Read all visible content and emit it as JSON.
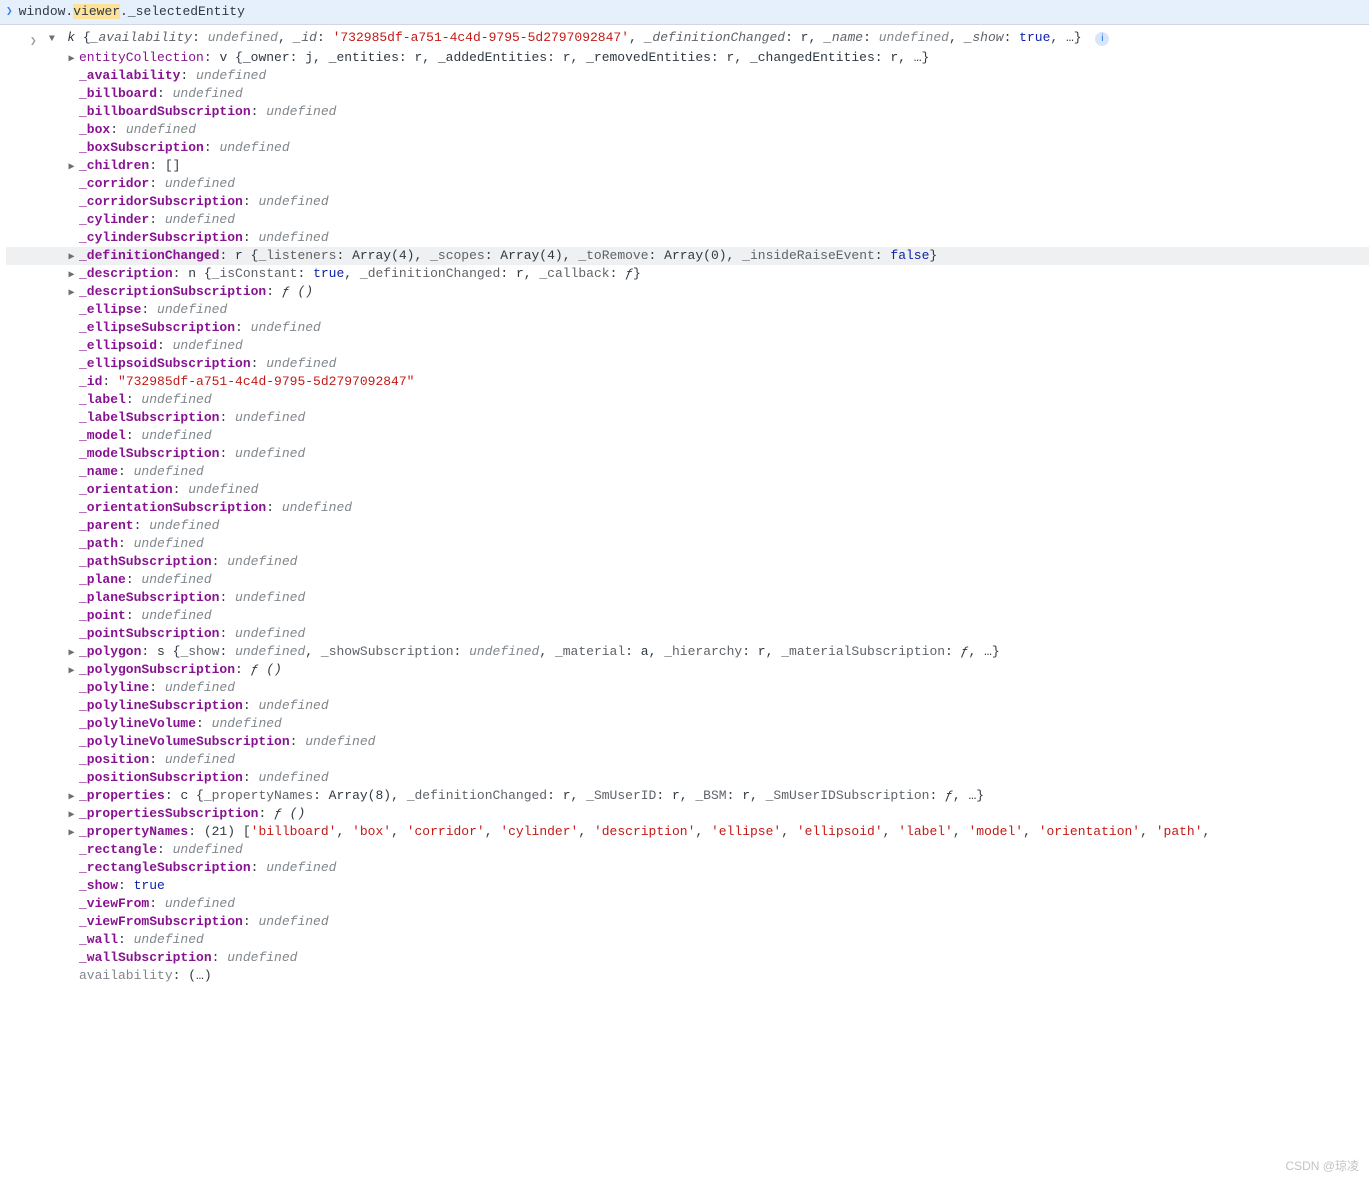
{
  "input": {
    "prefix": "window.",
    "highlight": "viewer",
    "suffix": "._selectedEntity"
  },
  "header": {
    "class": "k",
    "preview": [
      {
        "k": "_availability",
        "v": "undefined",
        "t": "und"
      },
      {
        "k": "_id",
        "v": "'732985df-a751-4c4d-9795-5d2797092847'",
        "t": "str"
      },
      {
        "k": "_definitionChanged",
        "v": "r",
        "t": "dark"
      },
      {
        "k": "_name",
        "v": "undefined",
        "t": "und"
      },
      {
        "k": "_show",
        "v": "true",
        "t": "bool"
      }
    ],
    "ellipsis": "…"
  },
  "rows": [
    {
      "tw": "right",
      "key": "entityCollection",
      "bold": false,
      "inline": "v {_owner: j, _entities: r, _addedEntities: r, _removedEntities: r, _changedEntities: r, …}"
    },
    {
      "tw": "none",
      "key": "_availability",
      "bold": true,
      "val": "undefined",
      "vt": "und"
    },
    {
      "tw": "none",
      "key": "_billboard",
      "bold": true,
      "val": "undefined",
      "vt": "und"
    },
    {
      "tw": "none",
      "key": "_billboardSubscription",
      "bold": true,
      "val": "undefined",
      "vt": "und"
    },
    {
      "tw": "none",
      "key": "_box",
      "bold": true,
      "val": "undefined",
      "vt": "und"
    },
    {
      "tw": "none",
      "key": "_boxSubscription",
      "bold": true,
      "val": "undefined",
      "vt": "und"
    },
    {
      "tw": "right",
      "key": "_children",
      "bold": true,
      "val": "[]",
      "vt": "dark"
    },
    {
      "tw": "none",
      "key": "_corridor",
      "bold": true,
      "val": "undefined",
      "vt": "und"
    },
    {
      "tw": "none",
      "key": "_corridorSubscription",
      "bold": true,
      "val": "undefined",
      "vt": "und"
    },
    {
      "tw": "none",
      "key": "_cylinder",
      "bold": true,
      "val": "undefined",
      "vt": "und"
    },
    {
      "tw": "none",
      "key": "_cylinderSubscription",
      "bold": true,
      "val": "undefined",
      "vt": "und"
    },
    {
      "tw": "right",
      "key": "_definitionChanged",
      "bold": true,
      "hover": true,
      "inlineParts": [
        {
          "txt": "r {",
          "t": "dark"
        },
        {
          "txt": "_listeners",
          "t": "grey"
        },
        {
          "txt": ": Array(4), ",
          "t": "dark"
        },
        {
          "txt": "_scopes",
          "t": "grey"
        },
        {
          "txt": ": Array(4), ",
          "t": "dark"
        },
        {
          "txt": "_toRemove",
          "t": "grey"
        },
        {
          "txt": ": Array(0), ",
          "t": "dark"
        },
        {
          "txt": "_insideRaiseEvent",
          "t": "grey"
        },
        {
          "txt": ": ",
          "t": "dark"
        },
        {
          "txt": "false",
          "t": "bool"
        },
        {
          "txt": "}",
          "t": "dark"
        }
      ]
    },
    {
      "tw": "right",
      "key": "_description",
      "bold": true,
      "inlineParts": [
        {
          "txt": "n {",
          "t": "dark"
        },
        {
          "txt": "_isConstant",
          "t": "grey"
        },
        {
          "txt": ": ",
          "t": "dark"
        },
        {
          "txt": "true",
          "t": "bool"
        },
        {
          "txt": ", ",
          "t": "dark"
        },
        {
          "txt": "_definitionChanged",
          "t": "grey"
        },
        {
          "txt": ": r, ",
          "t": "dark"
        },
        {
          "txt": "_callback",
          "t": "grey"
        },
        {
          "txt": ": ",
          "t": "dark"
        },
        {
          "txt": "ƒ",
          "t": "fn"
        },
        {
          "txt": "}",
          "t": "dark"
        }
      ]
    },
    {
      "tw": "right",
      "key": "_descriptionSubscription",
      "bold": true,
      "val": "ƒ ()",
      "vt": "fn"
    },
    {
      "tw": "none",
      "key": "_ellipse",
      "bold": true,
      "val": "undefined",
      "vt": "und"
    },
    {
      "tw": "none",
      "key": "_ellipseSubscription",
      "bold": true,
      "val": "undefined",
      "vt": "und"
    },
    {
      "tw": "none",
      "key": "_ellipsoid",
      "bold": true,
      "val": "undefined",
      "vt": "und"
    },
    {
      "tw": "none",
      "key": "_ellipsoidSubscription",
      "bold": true,
      "val": "undefined",
      "vt": "und"
    },
    {
      "tw": "none",
      "key": "_id",
      "bold": true,
      "val": "\"732985df-a751-4c4d-9795-5d2797092847\"",
      "vt": "str"
    },
    {
      "tw": "none",
      "key": "_label",
      "bold": true,
      "val": "undefined",
      "vt": "und"
    },
    {
      "tw": "none",
      "key": "_labelSubscription",
      "bold": true,
      "val": "undefined",
      "vt": "und"
    },
    {
      "tw": "none",
      "key": "_model",
      "bold": true,
      "val": "undefined",
      "vt": "und"
    },
    {
      "tw": "none",
      "key": "_modelSubscription",
      "bold": true,
      "val": "undefined",
      "vt": "und"
    },
    {
      "tw": "none",
      "key": "_name",
      "bold": true,
      "val": "undefined",
      "vt": "und"
    },
    {
      "tw": "none",
      "key": "_orientation",
      "bold": true,
      "val": "undefined",
      "vt": "und"
    },
    {
      "tw": "none",
      "key": "_orientationSubscription",
      "bold": true,
      "val": "undefined",
      "vt": "und"
    },
    {
      "tw": "none",
      "key": "_parent",
      "bold": true,
      "val": "undefined",
      "vt": "und"
    },
    {
      "tw": "none",
      "key": "_path",
      "bold": true,
      "val": "undefined",
      "vt": "und"
    },
    {
      "tw": "none",
      "key": "_pathSubscription",
      "bold": true,
      "val": "undefined",
      "vt": "und"
    },
    {
      "tw": "none",
      "key": "_plane",
      "bold": true,
      "val": "undefined",
      "vt": "und"
    },
    {
      "tw": "none",
      "key": "_planeSubscription",
      "bold": true,
      "val": "undefined",
      "vt": "und"
    },
    {
      "tw": "none",
      "key": "_point",
      "bold": true,
      "val": "undefined",
      "vt": "und"
    },
    {
      "tw": "none",
      "key": "_pointSubscription",
      "bold": true,
      "val": "undefined",
      "vt": "und"
    },
    {
      "tw": "right",
      "key": "_polygon",
      "bold": true,
      "inlineParts": [
        {
          "txt": "s {",
          "t": "dark"
        },
        {
          "txt": "_show",
          "t": "grey"
        },
        {
          "txt": ": ",
          "t": "dark"
        },
        {
          "txt": "undefined",
          "t": "und"
        },
        {
          "txt": ", ",
          "t": "dark"
        },
        {
          "txt": "_showSubscription",
          "t": "grey"
        },
        {
          "txt": ": ",
          "t": "dark"
        },
        {
          "txt": "undefined",
          "t": "und"
        },
        {
          "txt": ", ",
          "t": "dark"
        },
        {
          "txt": "_material",
          "t": "grey"
        },
        {
          "txt": ": a, ",
          "t": "dark"
        },
        {
          "txt": "_hierarchy",
          "t": "grey"
        },
        {
          "txt": ": r, ",
          "t": "dark"
        },
        {
          "txt": "_materialSubscription",
          "t": "grey"
        },
        {
          "txt": ": ",
          "t": "dark"
        },
        {
          "txt": "ƒ",
          "t": "fn"
        },
        {
          "txt": ", …}",
          "t": "dark"
        }
      ]
    },
    {
      "tw": "right",
      "key": "_polygonSubscription",
      "bold": true,
      "val": "ƒ ()",
      "vt": "fn"
    },
    {
      "tw": "none",
      "key": "_polyline",
      "bold": true,
      "val": "undefined",
      "vt": "und"
    },
    {
      "tw": "none",
      "key": "_polylineSubscription",
      "bold": true,
      "val": "undefined",
      "vt": "und"
    },
    {
      "tw": "none",
      "key": "_polylineVolume",
      "bold": true,
      "val": "undefined",
      "vt": "und"
    },
    {
      "tw": "none",
      "key": "_polylineVolumeSubscription",
      "bold": true,
      "val": "undefined",
      "vt": "und"
    },
    {
      "tw": "none",
      "key": "_position",
      "bold": true,
      "val": "undefined",
      "vt": "und"
    },
    {
      "tw": "none",
      "key": "_positionSubscription",
      "bold": true,
      "val": "undefined",
      "vt": "und"
    },
    {
      "tw": "right",
      "key": "_properties",
      "bold": true,
      "inlineParts": [
        {
          "txt": "c {",
          "t": "dark"
        },
        {
          "txt": "_propertyNames",
          "t": "grey"
        },
        {
          "txt": ": Array(8), ",
          "t": "dark"
        },
        {
          "txt": "_definitionChanged",
          "t": "grey"
        },
        {
          "txt": ": r, ",
          "t": "dark"
        },
        {
          "txt": "_SmUserID",
          "t": "grey"
        },
        {
          "txt": ": r, ",
          "t": "dark"
        },
        {
          "txt": "_BSM",
          "t": "grey"
        },
        {
          "txt": ": r, ",
          "t": "dark"
        },
        {
          "txt": "_SmUserIDSubscription",
          "t": "grey"
        },
        {
          "txt": ": ",
          "t": "dark"
        },
        {
          "txt": "ƒ",
          "t": "fn"
        },
        {
          "txt": ", …}",
          "t": "dark"
        }
      ]
    },
    {
      "tw": "right",
      "key": "_propertiesSubscription",
      "bold": true,
      "val": "ƒ ()",
      "vt": "fn"
    },
    {
      "tw": "right",
      "key": "_propertyNames",
      "bold": true,
      "inlineParts": [
        {
          "txt": "(21) [",
          "t": "dark"
        },
        {
          "txt": "'billboard'",
          "t": "str"
        },
        {
          "txt": ", ",
          "t": "dark"
        },
        {
          "txt": "'box'",
          "t": "str"
        },
        {
          "txt": ", ",
          "t": "dark"
        },
        {
          "txt": "'corridor'",
          "t": "str"
        },
        {
          "txt": ", ",
          "t": "dark"
        },
        {
          "txt": "'cylinder'",
          "t": "str"
        },
        {
          "txt": ", ",
          "t": "dark"
        },
        {
          "txt": "'description'",
          "t": "str"
        },
        {
          "txt": ", ",
          "t": "dark"
        },
        {
          "txt": "'ellipse'",
          "t": "str"
        },
        {
          "txt": ", ",
          "t": "dark"
        },
        {
          "txt": "'ellipsoid'",
          "t": "str"
        },
        {
          "txt": ", ",
          "t": "dark"
        },
        {
          "txt": "'label'",
          "t": "str"
        },
        {
          "txt": ", ",
          "t": "dark"
        },
        {
          "txt": "'model'",
          "t": "str"
        },
        {
          "txt": ", ",
          "t": "dark"
        },
        {
          "txt": "'orientation'",
          "t": "str"
        },
        {
          "txt": ", ",
          "t": "dark"
        },
        {
          "txt": "'path'",
          "t": "str"
        },
        {
          "txt": ",",
          "t": "dark"
        }
      ]
    },
    {
      "tw": "none",
      "key": "_rectangle",
      "bold": true,
      "val": "undefined",
      "vt": "und"
    },
    {
      "tw": "none",
      "key": "_rectangleSubscription",
      "bold": true,
      "val": "undefined",
      "vt": "und"
    },
    {
      "tw": "none",
      "key": "_show",
      "bold": true,
      "val": "true",
      "vt": "bool"
    },
    {
      "tw": "none",
      "key": "_viewFrom",
      "bold": true,
      "val": "undefined",
      "vt": "und"
    },
    {
      "tw": "none",
      "key": "_viewFromSubscription",
      "bold": true,
      "val": "undefined",
      "vt": "und"
    },
    {
      "tw": "none",
      "key": "_wall",
      "bold": true,
      "val": "undefined",
      "vt": "und"
    },
    {
      "tw": "none",
      "key": "_wallSubscription",
      "bold": true,
      "val": "undefined",
      "vt": "und"
    },
    {
      "tw": "none",
      "key": "availability",
      "bold": false,
      "getter": true,
      "val": "(…)",
      "vt": "dark"
    }
  ],
  "watermark": "CSDN @琼凌"
}
